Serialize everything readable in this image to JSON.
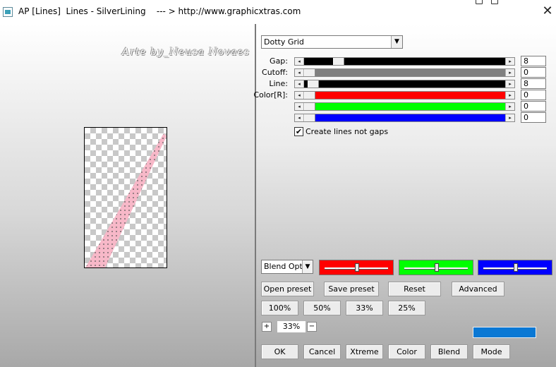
{
  "window": {
    "title": "AP [Lines]  Lines - SilverLining    --- > http://www.graphicxtras.com",
    "close_glyph": "✕"
  },
  "preview": {
    "watermark": "Arte by_Neusa Novaes"
  },
  "effect_select": {
    "value": "Dotty Grid",
    "arrow": "▼"
  },
  "sliders": [
    {
      "label": "Gap:",
      "value": "8",
      "fill": "#000000",
      "level": 0.15
    },
    {
      "label": "Cutoff:",
      "value": "0",
      "fill": "#808080",
      "level": 0.0
    },
    {
      "label": "Line:",
      "value": "8",
      "fill": "#000000",
      "level": 0.02
    },
    {
      "label": "Color[R]:",
      "value": "0",
      "fill": "#ff0000",
      "level": 0.0
    },
    {
      "label": "",
      "value": "0",
      "fill": "#00ff00",
      "level": 0.0
    },
    {
      "label": "",
      "value": "0",
      "fill": "#0000ff",
      "level": 0.0
    }
  ],
  "arrows": {
    "left": "◂",
    "right": "▸"
  },
  "checkbox": {
    "label": "Create lines not gaps",
    "checked": "✔"
  },
  "blend_select": {
    "value": "Blend Optio",
    "arrow": "▼"
  },
  "color_sliders": [
    {
      "color": "#ff0000",
      "level": 0.5
    },
    {
      "color": "#00ff00",
      "level": 0.5
    },
    {
      "color": "#0000ff",
      "level": 0.5
    }
  ],
  "buttons_row1": {
    "open_preset": "Open preset",
    "save_preset": "Save preset",
    "reset": "Reset",
    "advanced": "Advanced"
  },
  "zoom_buttons": {
    "z100": "100%",
    "z50": "50%",
    "z33": "33%",
    "z25": "25%"
  },
  "zoom": {
    "plus": "+",
    "value": "33%",
    "minus": "−"
  },
  "swatch_color": "#0a78d4",
  "bottom_buttons": {
    "ok": "OK",
    "cancel": "Cancel",
    "xtreme": "Xtreme",
    "color": "Color",
    "blend": "Blend",
    "mode": "Mode"
  }
}
